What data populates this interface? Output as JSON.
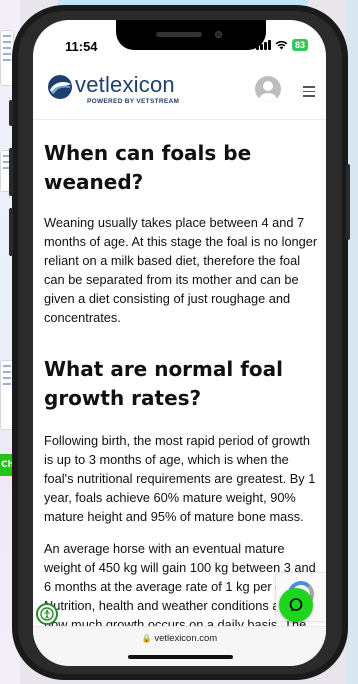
{
  "status_bar": {
    "time": "11:54",
    "battery": "83"
  },
  "header": {
    "logo_text": "vetlexicon",
    "logo_tagline": "POWERED BY VETSTREAM"
  },
  "article": {
    "heading_1": "When can foals be weaned?",
    "paragraph_1": "Weaning usually takes place between 4 and 7 months of age. At this stage the foal is no longer reliant on a milk based diet, therefore the foal can be separated from its mother and can be given a diet consisting of just roughage and concentrates.",
    "heading_2": "What are normal foal growth rates?",
    "paragraph_2": "Following birth, the most rapid period of growth is up to 3 months of age, which is when the foal's nutritional requirements are greatest. By 1 year, foals achieve 60% mature weight, 90% mature height and 95% of mature bone mass.",
    "paragraph_3": "An average horse with an eventual mature weight of 450 kg will gain 100 kg between 3 and 6 months at the average rate of 1 kg per day. Nutrition, health and weather conditions affect how much growth occurs on a daily basis. The"
  },
  "browser": {
    "url": "vetlexicon.com"
  },
  "colors": {
    "brand_navy": "#1f3f6e",
    "chat_green": "#1fd41f",
    "battery_green": "#34c759"
  }
}
